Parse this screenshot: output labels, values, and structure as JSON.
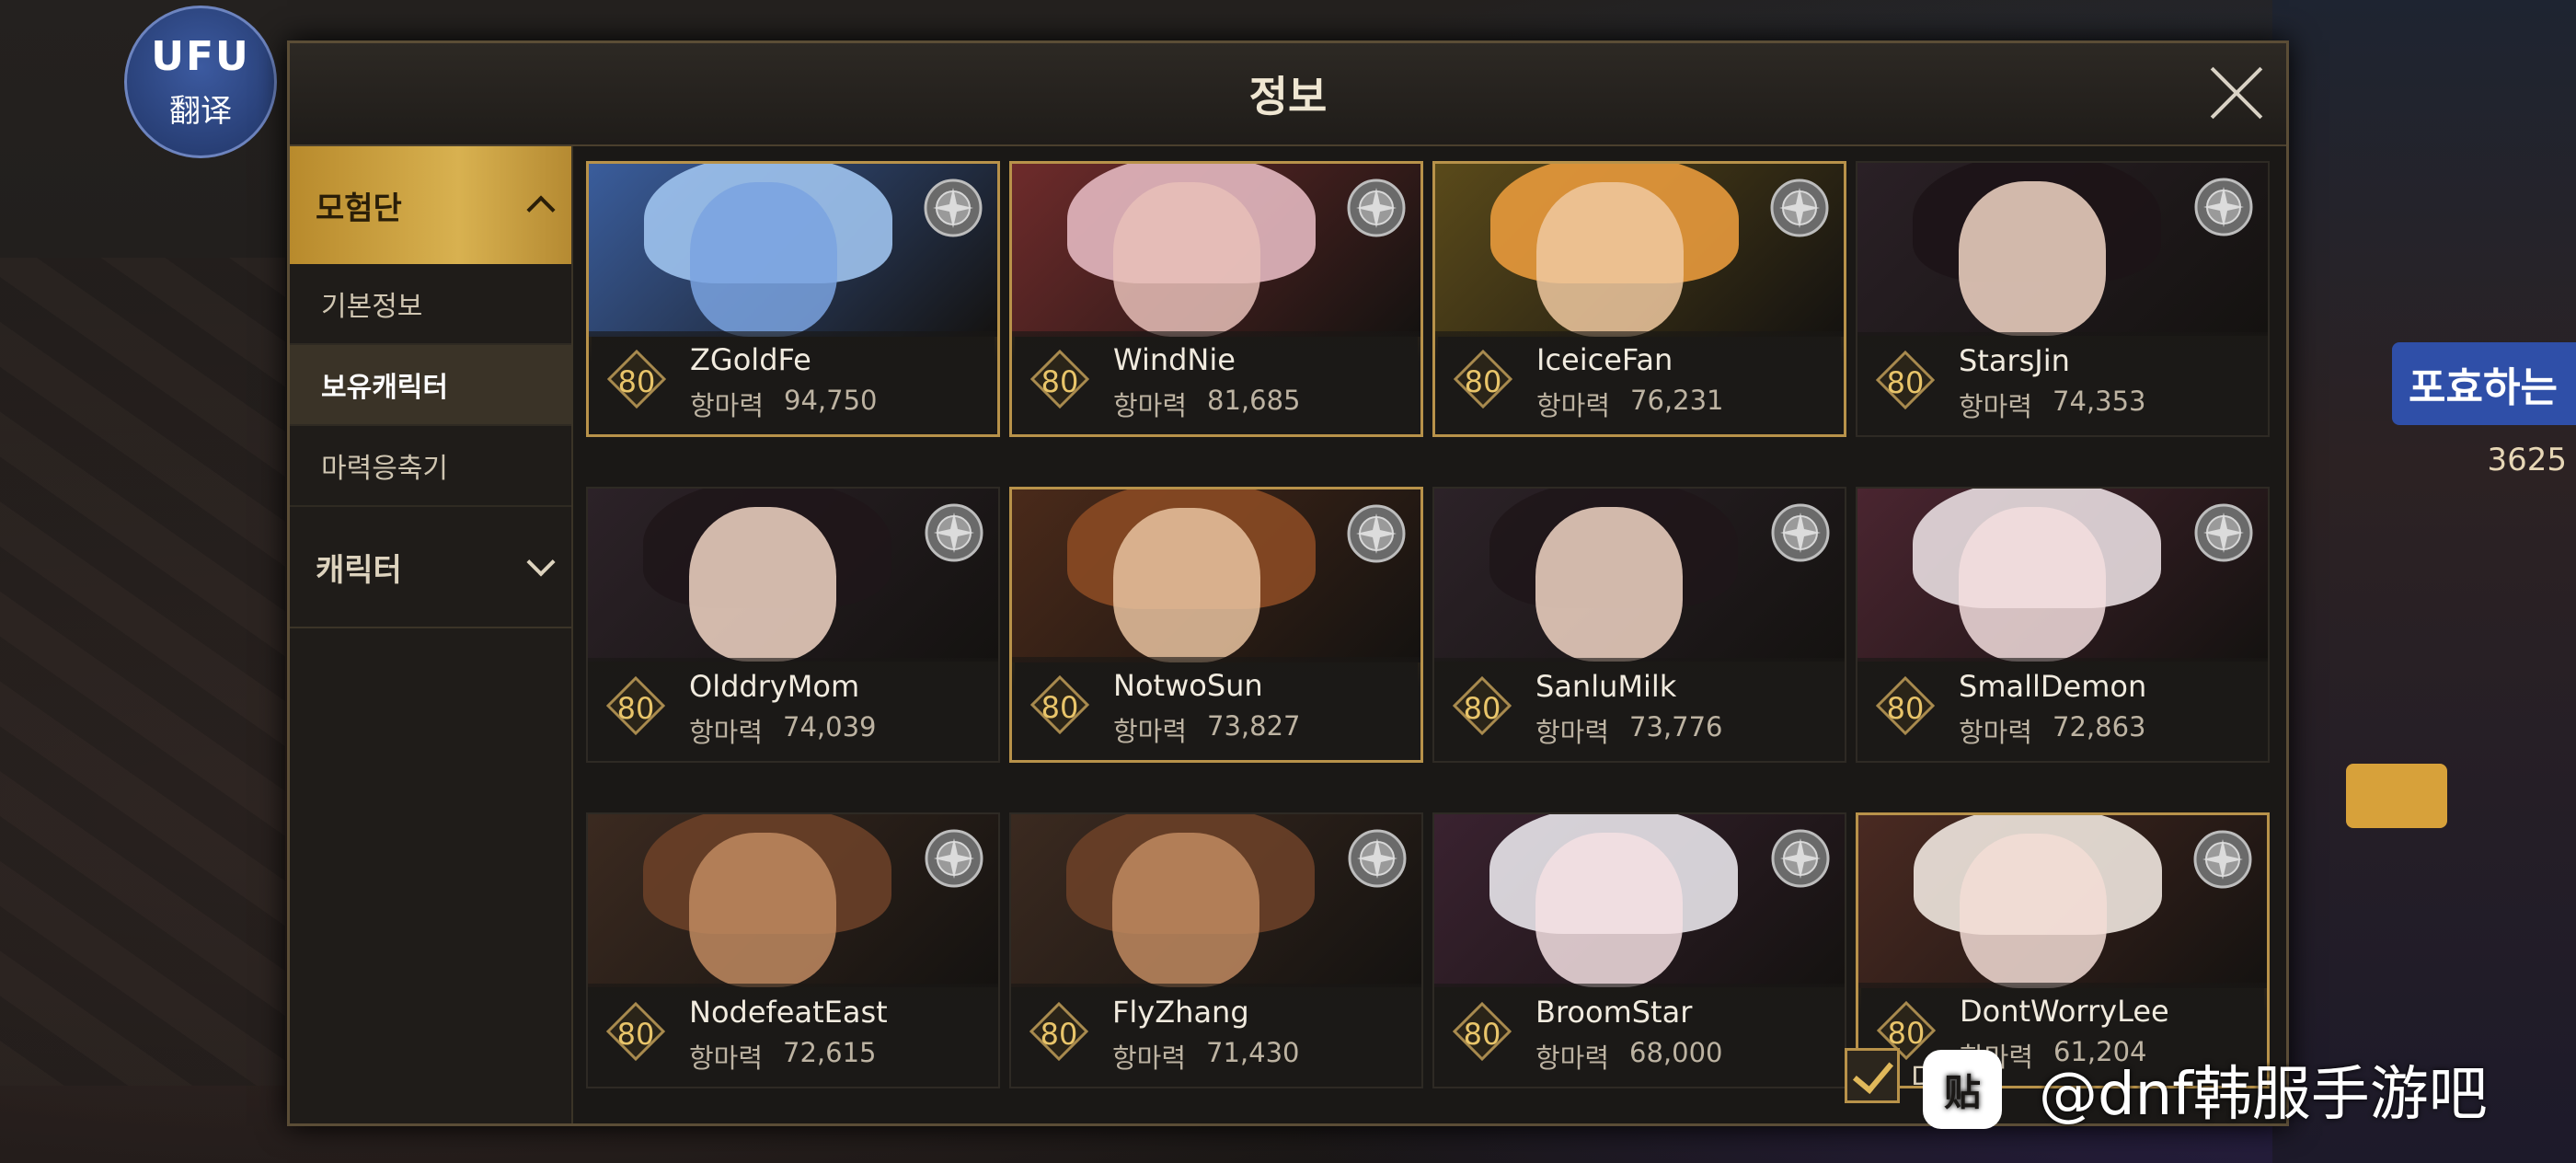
{
  "overlay": {
    "translate_logo": "UFU",
    "translate_label": "翻译",
    "right_banner": "포효하는",
    "right_amount": "3625"
  },
  "dialog": {
    "title": "정보"
  },
  "sidebar": {
    "groups": [
      {
        "label": "모험단",
        "expanded": true,
        "items": [
          {
            "label": "기본정보",
            "active": false
          },
          {
            "label": "보유캐릭터",
            "active": true
          },
          {
            "label": "마력응축기",
            "active": false
          }
        ]
      },
      {
        "label": "캐릭터",
        "expanded": false
      }
    ]
  },
  "power_label": "항마력",
  "characters": [
    {
      "name": "ZGoldFe",
      "level": "80",
      "power": "94,750",
      "highlight": true
    },
    {
      "name": "WindNie",
      "level": "80",
      "power": "81,685",
      "highlight": true
    },
    {
      "name": "IceiceFan",
      "level": "80",
      "power": "76,231",
      "highlight": true
    },
    {
      "name": "StarsJin",
      "level": "80",
      "power": "74,353",
      "highlight": false
    },
    {
      "name": "OlddryMom",
      "level": "80",
      "power": "74,039",
      "highlight": false
    },
    {
      "name": "NotwoSun",
      "level": "80",
      "power": "73,827",
      "highlight": true
    },
    {
      "name": "SanluMilk",
      "level": "80",
      "power": "73,776",
      "highlight": false
    },
    {
      "name": "SmallDemon",
      "level": "80",
      "power": "72,863",
      "highlight": false
    },
    {
      "name": "NodefeatEast",
      "level": "80",
      "power": "72,615",
      "highlight": false
    },
    {
      "name": "FlyZhang",
      "level": "80",
      "power": "71,430",
      "highlight": false
    },
    {
      "name": "BroomStar",
      "level": "80",
      "power": "68,000",
      "highlight": false
    },
    {
      "name": "DontWorryLee",
      "level": "80",
      "power": "61,204",
      "highlight": true
    }
  ],
  "footer": {
    "checkbox_checked": true,
    "checkbox_label": "다"
  },
  "watermark": {
    "icon": "贴",
    "text": "@dnf韩服手游吧"
  },
  "colors": {
    "gold_accent": "#d8b150",
    "highlight_border": "#b8924a",
    "level_text": "#e9c56a"
  }
}
